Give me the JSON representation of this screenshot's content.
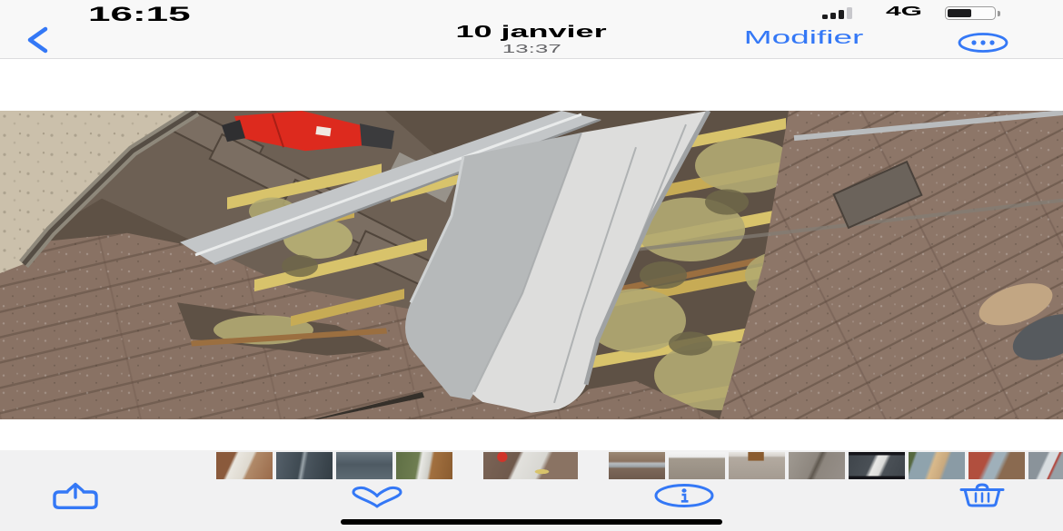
{
  "status_bar": {
    "time": "16:15",
    "network": "4G",
    "signal_filled": 3,
    "signal_total": 4,
    "battery_percent": 55
  },
  "nav_bar": {
    "title": "10 janvier",
    "subtitle": "13:37",
    "edit_label": "Modifier"
  },
  "photo": {
    "description": "Toiture en reparation : tuiles brunes deposees, liteaux bois et laine isolante apparents, ecran de sous-toiture blanc deplie, cloueur rouge pose en haut, bande de zinc argentee",
    "palette": {
      "wall": "#cbc0ab",
      "tile_brown": "#897264",
      "tile_brown_right": "#8d7668",
      "tile_dark_band": "#6d6054",
      "under_roof": "#5e5145",
      "batten_yellow": "#d8c36b",
      "batten_yellow2": "#c7ab55",
      "batten_wood": "#9b6f40",
      "insulation": "#b2aa72",
      "insulation_dark": "#6e6749",
      "membrane_white": "#dddddc",
      "membrane_grey": "#b6b9ba",
      "flashing_silver": "#c3c6c8",
      "tool_red": "#dd2a1e"
    }
  },
  "thumbnails": {
    "selected_index": 4,
    "items": [
      {
        "name": "membrane-on-battens",
        "background": "linear-gradient(115deg, #8a5a3c 0%, #8a5a3c 28%, #e9e6df 33%, #ded9cf 55%, #b08968 60%, #9a6a4a 100%)"
      },
      {
        "name": "slate-roof-silver-edge",
        "background": "linear-gradient(100deg, #55606a 0%, #3f4a52 42%, #9aa4aa 47%, #4a555e 53%, #333d44 100%)"
      },
      {
        "name": "metal-roof-panels",
        "background": "linear-gradient(180deg, #6a7780 0%, #4e5a63 45%, #5d6a73 100%)"
      },
      {
        "name": "gutter-over-garden",
        "background": "linear-gradient(100deg, #5f6f45 0%, #6e7d50 38%, #e8e8e4 44%, #cfcfc9 58%, #a2703f 63%, #8a5c30 100%)"
      },
      {
        "name": "roof-opening-membrane-current",
        "background": "radial-gradient(circle at 20% 18%, #d0342a 0, #d0342a 6%, rgba(0,0,0,0) 7%), radial-gradient(ellipse at 62% 72%, #d8c36b 0, #d8c36b 8%, rgba(0,0,0,0) 9%), linear-gradient(115deg, #7b6456 0%, #6f594c 34%, #e2e1dd 38%, #d8d7d2 60%, #8a7363 65%, #8a7363 100%)"
      },
      {
        "name": "tiled-roof-gutter",
        "background": "linear-gradient(180deg, #9a8874 0%, #8a7260 34%, #b8bcc0 42%, #9aa0a4 54%, #7d685a 60%, #6e5a4d 100%)"
      },
      {
        "name": "grey-roof-white-sky",
        "background": "linear-gradient(180deg, #f4f4f4 0%, #ececec 18%, #a39a8e 24%, #948b80 100%)"
      },
      {
        "name": "roof-with-chimney-box",
        "background": "linear-gradient(90deg, rgba(0,0,0,0) 0%, rgba(0,0,0,0) 34%, #8a5c30 35%, #8a5c30 62%, rgba(0,0,0,0) 63%) 0 0/100% 32% no-repeat, linear-gradient(180deg, #e8e6e2 0%, #d8d4cf 14%, #b3aaa0 20%, #a49b91 100%)"
      },
      {
        "name": "grey-roof-slab",
        "background": "linear-gradient(115deg, #a09a92 0%, #8d867e 44%, #5f584f 50%, #8d867e 57%, #97908a 100%)"
      },
      {
        "name": "dark-roof-white-membrane",
        "background": "linear-gradient(180deg, #15151a 0%, #15151a 12%, rgba(0,0,0,0) 12%), linear-gradient(0deg, #15151a 0%, #15151a 12%, rgba(0,0,0,0) 12%), linear-gradient(115deg, #3e444a 0%, #4a5056 40%, #e8e8e6 46%, #dcdcda 58%, #4a5056 64%, #3e444a 100%)"
      },
      {
        "name": "ridge-with-mortar",
        "background": "linear-gradient(110deg, #55683f 0%, #55683f 10%, #8fa3ad 14%, #8fa3ad 38%, #d9b98a 44%, #c9a97e 60%, #8a9ba5 66%, #8a9ba5 100%)"
      },
      {
        "name": "red-and-grey-roof",
        "background": "linear-gradient(115deg, #b14f3e 0%, #b14f3e 32%, #9fb0ba 40%, #9fb0ba 54%, #8a6a50 62%, #8a6a50 100%)"
      },
      {
        "name": "roofs-with-windows",
        "background": "linear-gradient(115deg, #8a939a 0%, #8a939a 28%, #d8dde0 32%, #d8dde0 44%, #b23b30 46%, #97a0a6 50%, #97a0a6 68%, #7d6c5c 74%, #7d6c5c 100%)"
      }
    ]
  },
  "toolbar": {
    "buttons": [
      {
        "name": "share",
        "icon": "share-icon"
      },
      {
        "name": "favorite",
        "icon": "heart-icon"
      },
      {
        "name": "info",
        "icon": "info-circle-icon"
      },
      {
        "name": "delete",
        "icon": "trash-icon"
      }
    ]
  },
  "colors": {
    "accent": "#3478F6",
    "bar_bg": "#f8f8f8",
    "toolbar_bg": "#f1f1f2",
    "hairline": "#dcdcde",
    "home_indicator": "#000000",
    "time_text": "#000000",
    "subtitle": "#636366",
    "signal_on": "#1c1c1e",
    "signal_off": "#c8c8cc",
    "battery_fill": "#1c1c1e",
    "battery_outline": "rgba(0,0,0,0.38)"
  }
}
